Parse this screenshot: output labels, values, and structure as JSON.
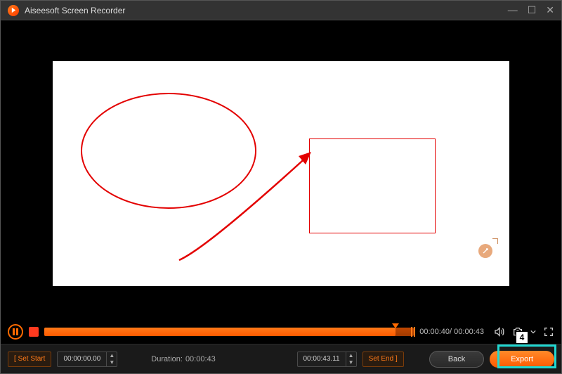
{
  "titlebar": {
    "app_name": "Aiseesoft Screen Recorder"
  },
  "player": {
    "current_time": "00:00:40",
    "total_time": "00:00:43"
  },
  "trim": {
    "set_start_label": "[ Set Start",
    "start_time": "00:00:00.00",
    "duration_label": "Duration:",
    "duration_value": "00:00:43",
    "end_time": "00:00:43.11",
    "set_end_label": "Set End ]"
  },
  "actions": {
    "back_label": "Back",
    "export_label": "Export"
  },
  "annotation": {
    "step_number": "4"
  }
}
